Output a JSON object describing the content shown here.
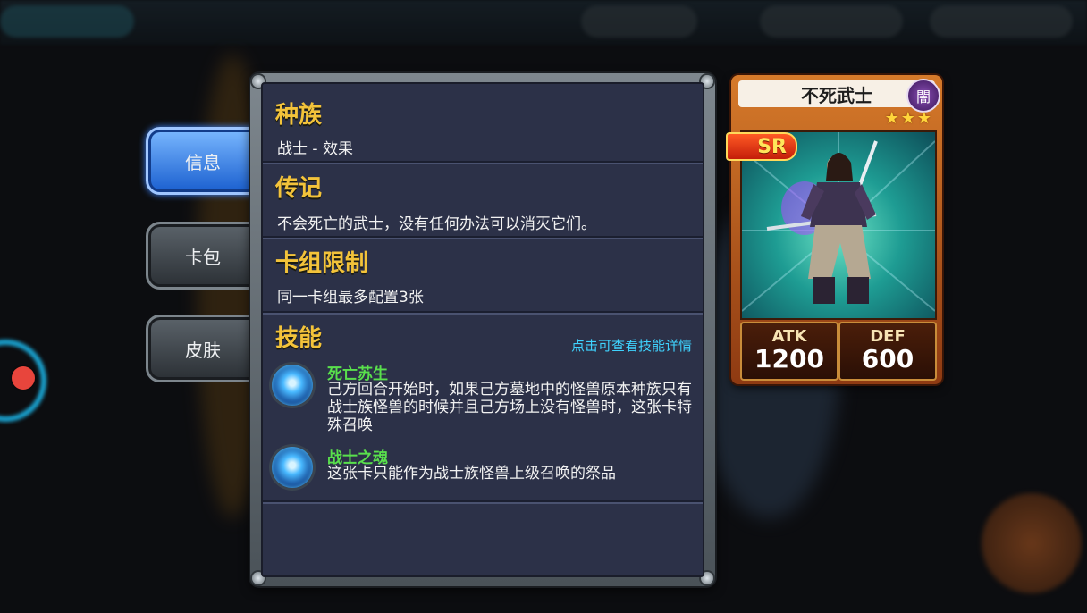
{
  "tabs": [
    {
      "label": "信息",
      "active": true
    },
    {
      "label": "卡包",
      "active": false
    },
    {
      "label": "皮肤",
      "active": false
    }
  ],
  "panel": {
    "race": {
      "title": "种族",
      "text": "战士 - 效果"
    },
    "lore": {
      "title": "传记",
      "text": "不会死亡的武士，没有任何办法可以消灭它们。"
    },
    "limit": {
      "title": "卡组限制",
      "text": "同一卡组最多配置3张"
    },
    "skills": {
      "title": "技能",
      "hint": "点击可查看技能详情",
      "items": [
        {
          "name": "死亡苏生",
          "desc": "己方回合开始时，如果己方墓地中的怪兽原本种族只有战士族怪兽的时候并且己方场上没有怪兽时，这张卡特殊召唤"
        },
        {
          "name": "战士之魂",
          "desc": "这张卡只能作为战士族怪兽上级召唤的祭品"
        }
      ]
    }
  },
  "card": {
    "name": "不死武士",
    "attribute": "闇",
    "rarity": "SR",
    "stars": 3,
    "atk_label": "ATK",
    "atk": "1200",
    "def_label": "DEF",
    "def": "600"
  },
  "colors": {
    "title": "#f3c33a",
    "skill_name": "#59e04c",
    "hint": "#3fd3ff",
    "active_tab": "#2f7ae5"
  }
}
